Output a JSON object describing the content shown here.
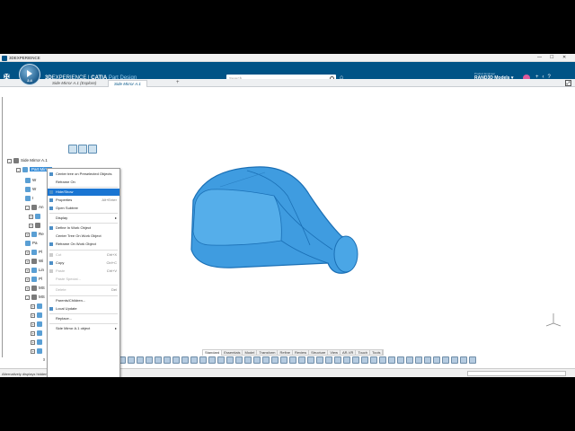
{
  "window": {
    "title": "3DEXPERIENCE",
    "controls": [
      "—",
      "☐",
      "✕"
    ]
  },
  "topbar": {
    "brand_3d": "3D",
    "brand_experience": "EXPERIENCE",
    "brand_sep": " | ",
    "brand_catia": "CATIA",
    "brand_app": " Part Design",
    "compass_version": "2.4",
    "search_placeholder": "Search",
    "user_role": "Product Engineer",
    "user_name": "RAND3D Models",
    "user_chevron": "▾"
  },
  "tabs": [
    {
      "label": "Side Mirror A.1 (Explore)"
    },
    {
      "label": "Side Mirror A.1"
    }
  ],
  "tab_add": "+",
  "tree": {
    "root": "Side Mirror A.1",
    "selected": "Part Mirror",
    "rows": [
      "W",
      "W",
      "I",
      "An",
      "",
      "",
      "Pa",
      "Re",
      "Pa",
      "Pl",
      "Wi",
      "Lin",
      "Pl",
      "MS",
      "MS"
    ],
    "trailing": "S A A A"
  },
  "context_menu": {
    "items": [
      {
        "label": "Center tree on Preselected Objects",
        "shortcut": "",
        "disabled": false,
        "highlight": false,
        "icon": true
      },
      {
        "label": "Reframe On",
        "shortcut": "",
        "disabled": false,
        "highlight": false,
        "icon": false
      },
      {
        "label": "Hide/Show",
        "shortcut": "",
        "disabled": false,
        "highlight": true,
        "icon": true
      },
      {
        "label": "Properties",
        "shortcut": "Alt+Enter",
        "disabled": false,
        "highlight": false,
        "icon": true
      },
      {
        "label": "Open Subtree",
        "shortcut": "",
        "disabled": false,
        "highlight": false,
        "icon": true
      },
      {
        "label": "Display",
        "shortcut": "",
        "disabled": false,
        "highlight": false,
        "icon": false,
        "submenu": true
      },
      {
        "label": "Define In Work Object",
        "shortcut": "",
        "disabled": false,
        "highlight": false,
        "icon": true
      },
      {
        "label": "Center Tree On Work Object",
        "shortcut": "",
        "disabled": false,
        "highlight": false,
        "icon": false
      },
      {
        "label": "Reframe On Work Object",
        "shortcut": "",
        "disabled": false,
        "highlight": false,
        "icon": true
      },
      {
        "label": "Cut",
        "shortcut": "Ctrl+X",
        "disabled": true,
        "highlight": false,
        "icon": true
      },
      {
        "label": "Copy",
        "shortcut": "Ctrl+C",
        "disabled": false,
        "highlight": false,
        "icon": true
      },
      {
        "label": "Paste",
        "shortcut": "Ctrl+V",
        "disabled": true,
        "highlight": false,
        "icon": true
      },
      {
        "label": "Paste Special...",
        "shortcut": "",
        "disabled": true,
        "highlight": false,
        "icon": false
      },
      {
        "label": "Delete",
        "shortcut": "Del",
        "disabled": true,
        "highlight": false,
        "icon": false
      },
      {
        "label": "Parents/Children...",
        "shortcut": "",
        "disabled": false,
        "highlight": false,
        "icon": false
      },
      {
        "label": "Local Update",
        "shortcut": "",
        "disabled": false,
        "highlight": false,
        "icon": true
      },
      {
        "label": "Replace...",
        "shortcut": "",
        "disabled": false,
        "highlight": false,
        "icon": false
      },
      {
        "label": "Side Mirror A.1 object",
        "shortcut": "",
        "disabled": false,
        "highlight": false,
        "icon": false,
        "submenu": true
      }
    ],
    "submenu_arrow": "▸"
  },
  "action_bar": {
    "tabs": [
      "Standard",
      "Essentials",
      "Model",
      "Transform",
      "Refine",
      "Review",
      "Structure",
      "View",
      "AR-VR",
      "Touch",
      "Tools"
    ],
    "active_tab": "Standard"
  },
  "status": {
    "message": "Alternatively displays hidden and shown objects"
  },
  "colors": {
    "brand": "#005386",
    "selection": "#1a75d2",
    "model": "#3f9ce0"
  },
  "icons": [
    "ds-logo-icon",
    "compass-icon",
    "search-icon",
    "tag-icon",
    "share-icon",
    "help-icon"
  ]
}
